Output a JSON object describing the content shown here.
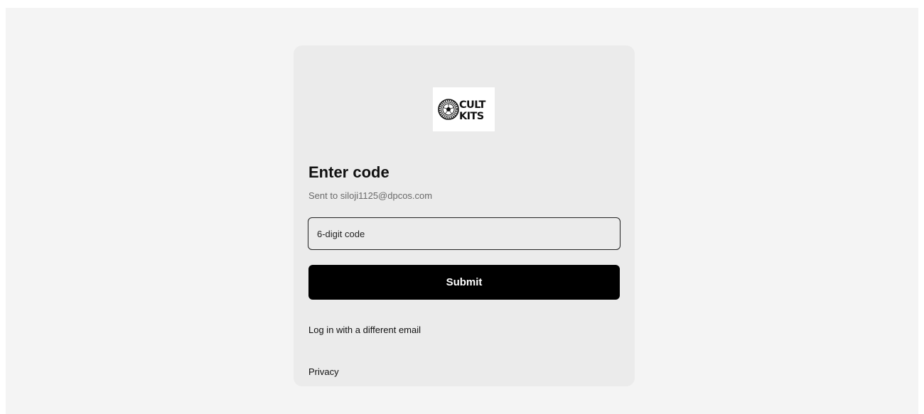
{
  "logo": {
    "text_line1": "CULT",
    "text_line2": "KITS",
    "emblem_text": "CULT KITS"
  },
  "heading": "Enter code",
  "sent_to": "Sent to siloji1125@dpcos.com",
  "code_field": {
    "placeholder": "6-digit code",
    "value": ""
  },
  "submit_label": "Submit",
  "different_email_link": "Log in with a different email",
  "privacy_link": "Privacy",
  "colors": {
    "page_background": "#f4f4f4",
    "card_background": "#ebebeb",
    "primary_button": "#000000",
    "primary_button_text": "#ffffff"
  }
}
